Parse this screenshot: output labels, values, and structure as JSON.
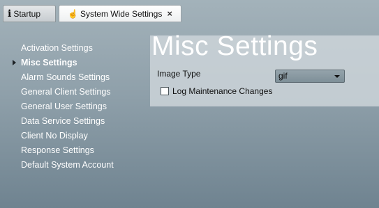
{
  "tabs": [
    {
      "label": "Startup",
      "icon": "info-icon"
    },
    {
      "label": "System Wide Settings",
      "icon": "hand-icon",
      "close": "×"
    }
  ],
  "sidebar": {
    "items": [
      {
        "label": "Activation Settings"
      },
      {
        "label": "Misc Settings",
        "selected": true
      },
      {
        "label": "Alarm Sounds Settings"
      },
      {
        "label": "General Client Settings"
      },
      {
        "label": "General User Settings"
      },
      {
        "label": "Data Service Settings"
      },
      {
        "label": "Client No Display"
      },
      {
        "label": "Response Settings"
      },
      {
        "label": "Default System Account"
      }
    ]
  },
  "panel": {
    "title": "Misc Settings",
    "image_type_label": "Image Type",
    "image_type_value": "gif",
    "log_label": "Log Maintenance Changes",
    "log_checked": false
  },
  "colors": {
    "accent_icon": "#e49a1c"
  }
}
